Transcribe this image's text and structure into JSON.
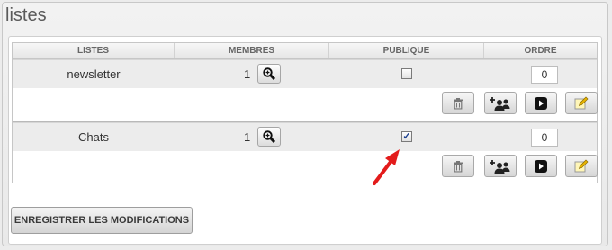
{
  "page": {
    "title": "listes"
  },
  "table": {
    "headers": {
      "lists": "LISTES",
      "members": "MEMBRES",
      "public": "PUBLIQUE",
      "order": "ORDRE"
    },
    "rows": [
      {
        "name": "newsletter",
        "members": "1",
        "public": false,
        "order": "0"
      },
      {
        "name": "Chats",
        "members": "1",
        "public": true,
        "check_mark": "✓",
        "order": "0"
      }
    ],
    "row_action_icons": [
      "trash-icon",
      "add-members-icon",
      "play-icon",
      "edit-icon"
    ]
  },
  "footer": {
    "save_label": "ENREGISTRER LES MODIFICATIONS"
  },
  "colors": {
    "arrow": "#e31b1b",
    "row_bg": "#ececec",
    "check": "#1b3f8f"
  }
}
